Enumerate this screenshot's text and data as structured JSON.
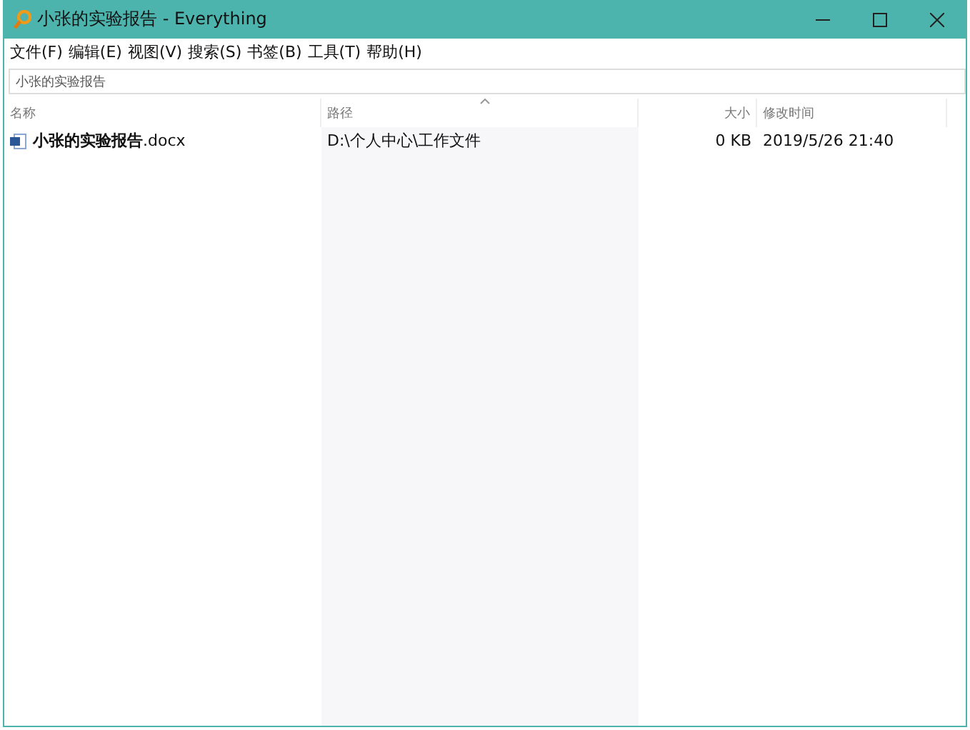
{
  "window": {
    "title": "小张的实验报告 - Everything"
  },
  "menu": [
    "文件(F)",
    "编辑(E)",
    "视图(V)",
    "搜索(S)",
    "书签(B)",
    "工具(T)",
    "帮助(H)"
  ],
  "search": {
    "value": "小张的实验报告"
  },
  "table": {
    "columns": [
      {
        "label": "名称",
        "kind": "name",
        "sorted": false
      },
      {
        "label": "路径",
        "kind": "path",
        "sorted": true
      },
      {
        "label": "大小",
        "kind": "size",
        "sorted": false
      },
      {
        "label": "修改时间",
        "kind": "date",
        "sorted": false
      }
    ],
    "rows": [
      {
        "name": "**小张的实验报告**.docx",
        "path": "D:\\个人中心\\工作文件",
        "size": "0 KB",
        "modified": "2019/5/26 21:40"
      }
    ]
  }
}
